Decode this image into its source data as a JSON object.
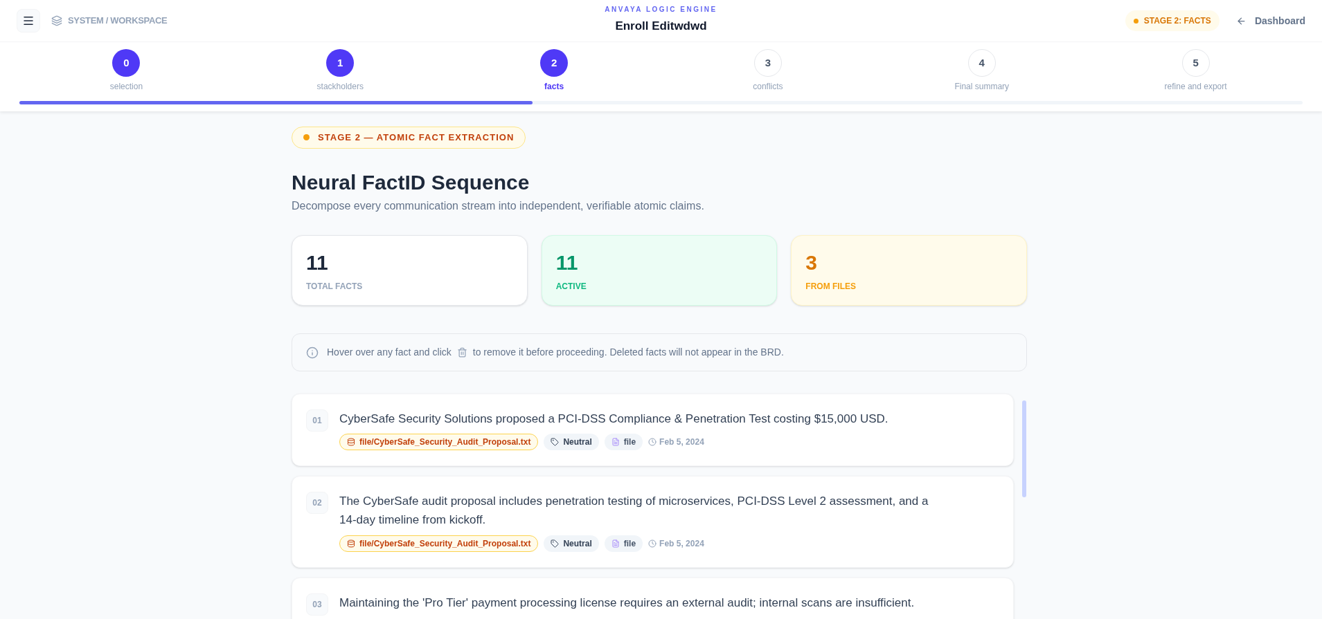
{
  "header": {
    "breadcrumb": "SYSTEM / WORKSPACE",
    "engine": "ANVAYA LOGIC ENGINE",
    "title": "Enroll Editwdwd",
    "stage_badge": "STAGE 2: FACTS",
    "back_link": "Dashboard"
  },
  "stepper": {
    "level": 0.4,
    "steps": [
      {
        "number": "0",
        "label": "selection",
        "done": true,
        "selected": false
      },
      {
        "number": "1",
        "label": "stackholders",
        "done": true,
        "selected": false
      },
      {
        "number": "2",
        "label": "facts",
        "done": true,
        "selected": true
      },
      {
        "number": "3",
        "label": "conflicts",
        "done": false,
        "selected": false
      },
      {
        "number": "4",
        "label": "Final summary",
        "done": false,
        "selected": false
      },
      {
        "number": "5",
        "label": "refine and export",
        "done": false,
        "selected": false
      }
    ]
  },
  "stage_label": "STAGE 2 — ATOMIC FACT EXTRACTION",
  "heading": "Neural FactID Sequence",
  "subheading": "Decompose every communication stream into independent, verifiable atomic claims.",
  "stats": [
    {
      "value": "11",
      "label": "TOTAL FACTS",
      "kind": "neutral"
    },
    {
      "value": "11",
      "label": "ACTIVE",
      "kind": "green"
    },
    {
      "value": "3",
      "label": "FROM FILES",
      "kind": "amber"
    }
  ],
  "notice": {
    "before": "Hover over any fact and click",
    "after": "to remove it before proceeding. Deleted facts will not appear in the BRD."
  },
  "facts": [
    {
      "number": "01",
      "text": "CyberSafe Security Solutions proposed a PCI-DSS Compliance & Penetration Test costing $15,000 USD.",
      "source": "file/CyberSafe_Security_Audit_Proposal.txt",
      "sentiment": "Neutral",
      "type": "file",
      "date": "Feb 5, 2024"
    },
    {
      "number": "02",
      "text": "The CyberSafe audit proposal includes penetration testing of microservices, PCI-DSS Level 2 assessment, and a 14-day timeline from kickoff.",
      "source": "file/CyberSafe_Security_Audit_Proposal.txt",
      "sentiment": "Neutral",
      "type": "file",
      "date": "Feb 5, 2024"
    },
    {
      "number": "03",
      "text": "Maintaining the 'Pro Tier' payment processing license requires an external audit; internal scans are insufficient."
    }
  ]
}
